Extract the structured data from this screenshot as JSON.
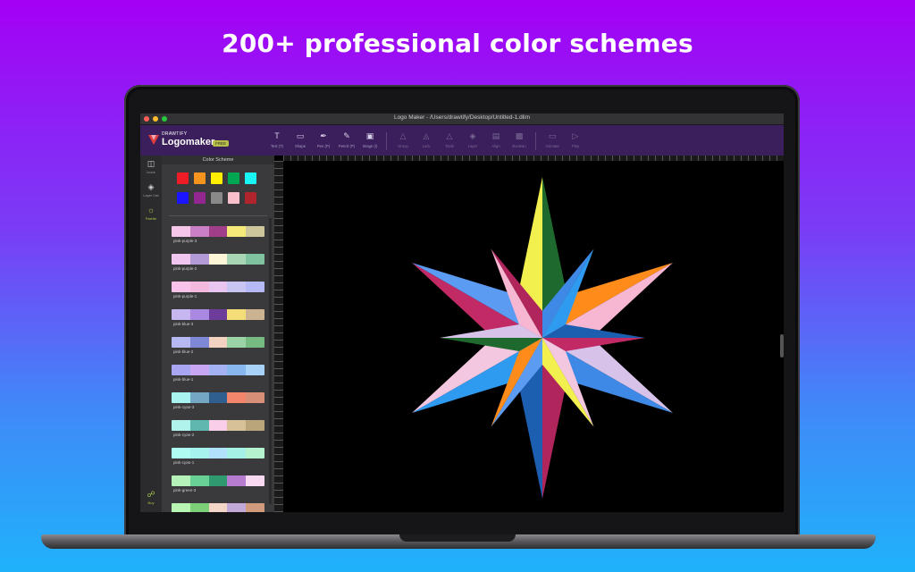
{
  "headline": "200+ professional color schemes",
  "window": {
    "title": "Logo Maker - /Users/drawtify/Desktop/Untitled-1.dlim",
    "traffic_lights": [
      "#fe5f57",
      "#febc2e",
      "#28c840"
    ]
  },
  "app": {
    "logo_small": "DRAWTIFY",
    "logo_name": "Logomaker",
    "badge": "FREE",
    "brand_color": "#3a1f5c",
    "accent": "#a6c84a"
  },
  "toolbar": {
    "tools": [
      {
        "label": "Text (T)",
        "icon": "text-icon"
      },
      {
        "label": "Shape",
        "icon": "shape-icon"
      },
      {
        "label": "Pen (P)",
        "icon": "pen-icon"
      },
      {
        "label": "Pencil (P)",
        "icon": "pencil-icon"
      },
      {
        "label": "Image (I)",
        "icon": "image-icon"
      },
      {
        "label": "Group",
        "icon": "group-icon"
      },
      {
        "label": "Lock",
        "icon": "lock-icon"
      },
      {
        "label": "Tools",
        "icon": "tools-icon"
      },
      {
        "label": "Layer",
        "icon": "layer-icon"
      },
      {
        "label": "Align",
        "icon": "align-icon"
      },
      {
        "label": "Boolean",
        "icon": "boolean-icon"
      },
      {
        "label": "Animate",
        "icon": "animate-icon"
      },
      {
        "label": "Play",
        "icon": "play-icon"
      }
    ]
  },
  "sidebar": {
    "items": [
      {
        "label": "Icons",
        "icon": "icons-icon"
      },
      {
        "label": "Layer List",
        "icon": "layers-icon"
      },
      {
        "label": "Palette",
        "icon": "palette-icon"
      },
      {
        "label": "Buy",
        "icon": "cart-icon"
      }
    ]
  },
  "panel": {
    "title": "Color Scheme",
    "swatches": [
      "#ee1c24",
      "#f7941d",
      "#ffee00",
      "#00a651",
      "#19f5f5",
      "#1b14ff",
      "#92278f",
      "#898989",
      "#f9c0cb",
      "#b0252b"
    ],
    "schemes": [
      {
        "name": "pink-purple-3",
        "colors": [
          "#f6c6ea",
          "#c980c4",
          "#a13e89",
          "#f5e97a",
          "#cdc59b"
        ]
      },
      {
        "name": "pink-purple-2",
        "colors": [
          "#f0c6f1",
          "#b39bd8",
          "#fdf6d6",
          "#a8d5b3",
          "#7fc29f"
        ]
      },
      {
        "name": "pink-purple-1",
        "colors": [
          "#f7c3ea",
          "#f4b9df",
          "#e8c6ef",
          "#c9c5f3",
          "#b5b9f5"
        ]
      },
      {
        "name": "pink-blue-3",
        "colors": [
          "#c7b7f0",
          "#a989e0",
          "#6c3e9a",
          "#f4dd76",
          "#cbb392"
        ]
      },
      {
        "name": "pink-blue-2",
        "colors": [
          "#b6b8f3",
          "#7e88d6",
          "#f3d2c2",
          "#99d3a6",
          "#76bb82"
        ]
      },
      {
        "name": "pink-blue-1",
        "colors": [
          "#a8a6f0",
          "#c8a6f3",
          "#a4b2f3",
          "#88b7f0",
          "#a8d2f7"
        ]
      },
      {
        "name": "pink-cyan-3",
        "colors": [
          "#a8f3ef",
          "#73a7c3",
          "#2e5f8f",
          "#f1866c",
          "#d88f77"
        ]
      },
      {
        "name": "pink-cyan-2",
        "colors": [
          "#b0f2ec",
          "#5fb7b0",
          "#f8cee8",
          "#d7c199",
          "#b8a67a"
        ]
      },
      {
        "name": "pink-cyan-1",
        "colors": [
          "#aefcf2",
          "#a6f2ee",
          "#b2e2fb",
          "#a6f1e6",
          "#b5f3ce"
        ]
      },
      {
        "name": "pink-green-3",
        "colors": [
          "#b5f2b9",
          "#6ad196",
          "#2f9a6f",
          "#b67ccf",
          "#f7daf2"
        ]
      },
      {
        "name": "",
        "colors": [
          "#b9f5b2",
          "#7ed078",
          "#f3d6c8",
          "#c2a7d9",
          "#d29a7c"
        ]
      }
    ]
  },
  "art": {
    "rays": [
      "#f2f04f",
      "#1e6a2e",
      "#ff8c1a",
      "#f7b6d2",
      "#d7c3e9",
      "#3f89e6",
      "#b0255b",
      "#1c5fb0",
      "#2e9bf0",
      "#f2c7df",
      "#c22a66",
      "#5b9bf2"
    ]
  }
}
